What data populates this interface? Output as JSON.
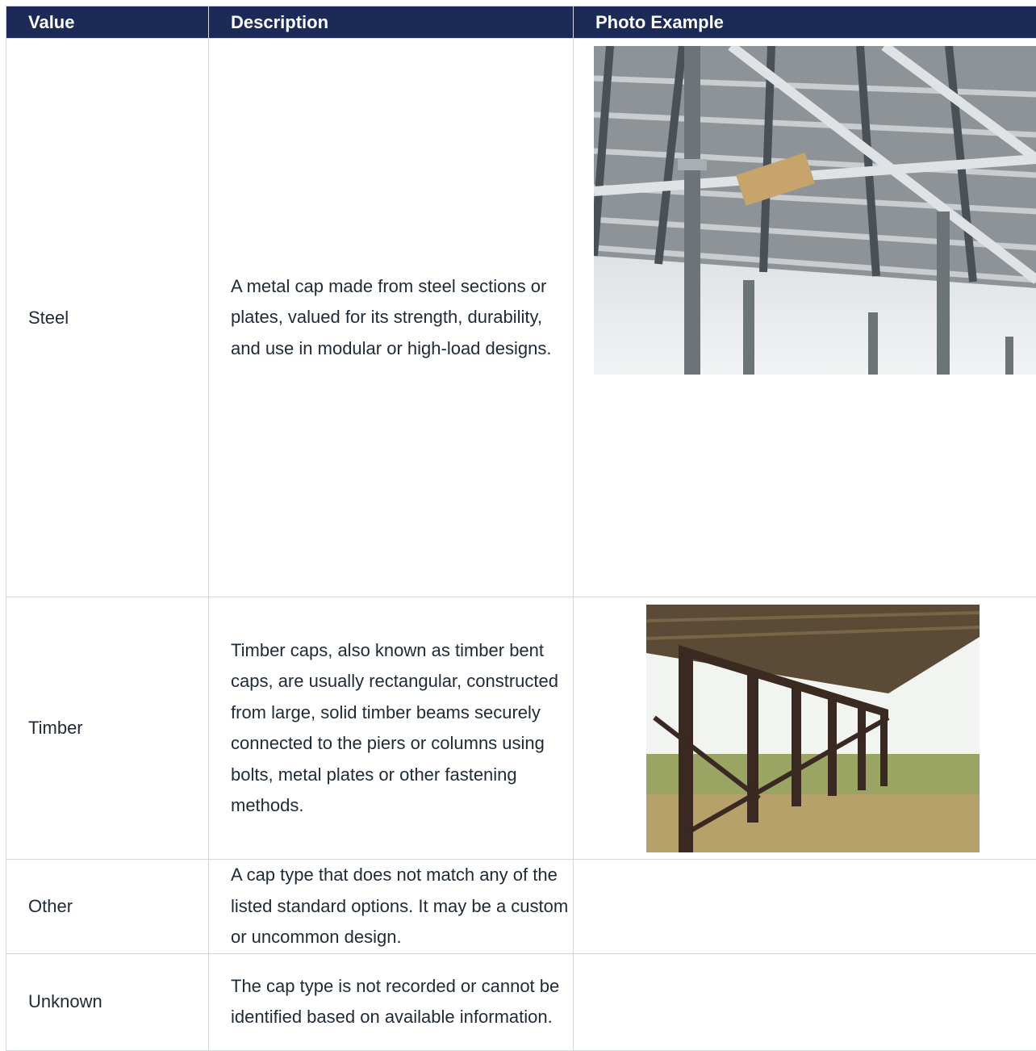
{
  "table": {
    "headers": [
      "Value",
      "Description",
      "Photo Example"
    ],
    "rows": [
      {
        "value": "Steel",
        "description": "A metal cap made from steel sections or plates, valued for its strength, durability, and use in modular or high-load designs.",
        "photo": "steel-formwork-photo"
      },
      {
        "value": "Timber",
        "description": "Timber caps, also known as timber bent caps, are usually rectangular, constructed from large, solid timber beams securely connected to the piers or columns using bolts, metal plates or other fastening methods.",
        "photo": "timber-bent-bridge-photo"
      },
      {
        "value": "Other",
        "description": "A cap type that does not match any of the listed standard options. It may be a custom or uncommon design.",
        "photo": ""
      },
      {
        "value": "Unknown",
        "description": "The cap type is not recorded or cannot be identified based on available information.",
        "photo": ""
      }
    ]
  },
  "colors": {
    "header_bg": "#1c2a57",
    "header_text": "#ffffff",
    "border": "#d4d7dc",
    "body_text": "#1f2a37"
  }
}
